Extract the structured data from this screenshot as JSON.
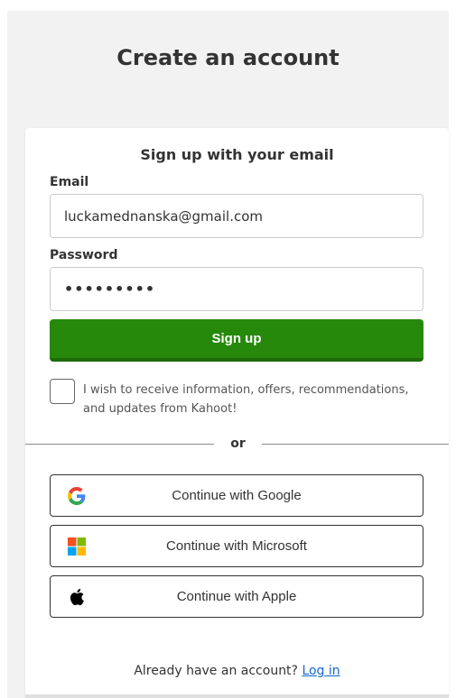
{
  "page": {
    "title": "Create an account"
  },
  "form": {
    "subtitle": "Sign up with your email",
    "email_label": "Email",
    "email_value": "luckamednanska@gmail.com",
    "password_label": "Password",
    "password_masked": "•••••••••",
    "submit_label": "Sign up",
    "consent_text": "I wish to receive information, offers, recommendations, and updates from Kahoot!",
    "consent_checked": false
  },
  "divider": {
    "text": "or"
  },
  "social": {
    "google": {
      "label": "Continue with Google",
      "icon": "google-icon"
    },
    "microsoft": {
      "label": "Continue with Microsoft",
      "icon": "microsoft-icon"
    },
    "apple": {
      "label": "Continue with Apple",
      "icon": "apple-icon"
    }
  },
  "footer": {
    "prompt": "Already have an account?",
    "link": "Log in"
  },
  "colors": {
    "primary_button": "#26890c",
    "link": "#1368ce",
    "page_background": "#f2f2f2"
  }
}
